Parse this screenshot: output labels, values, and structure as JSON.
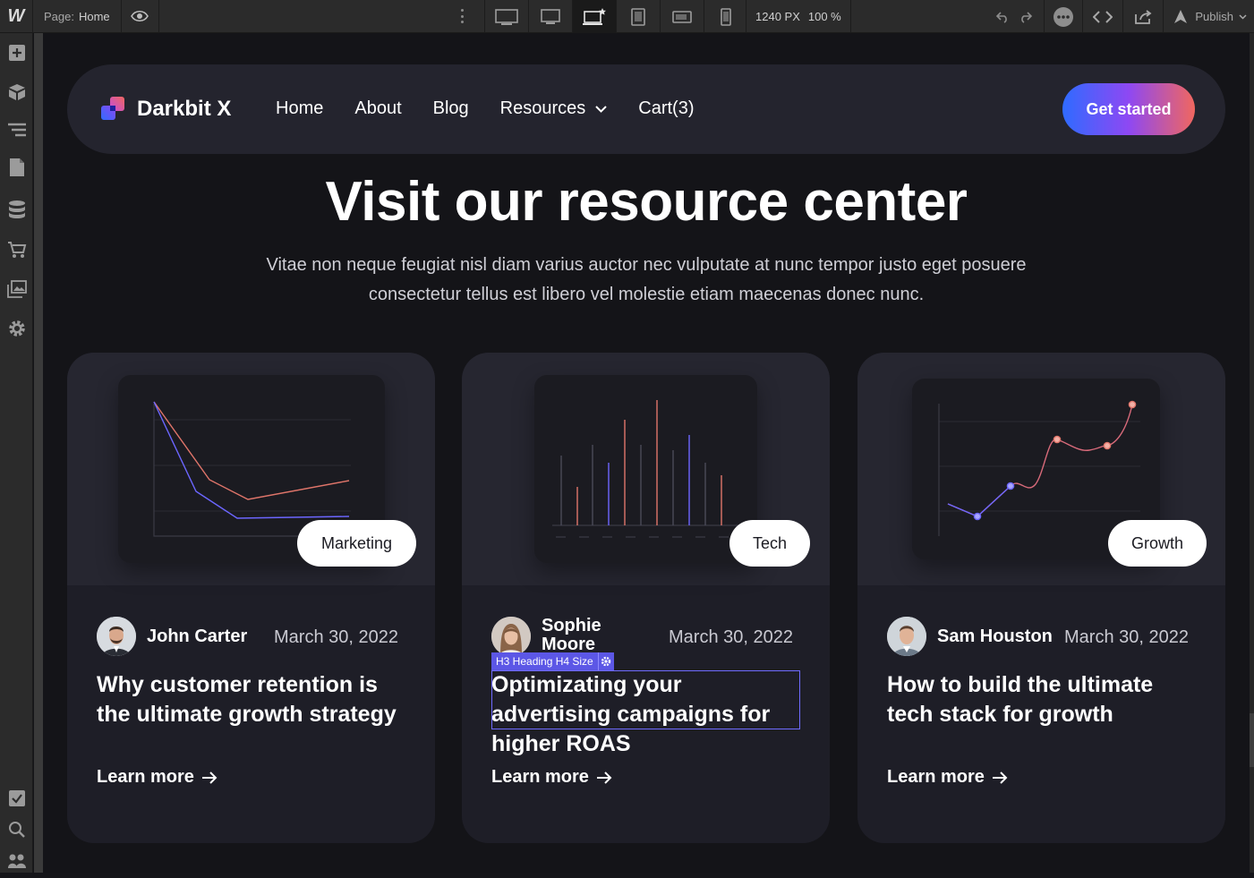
{
  "designer": {
    "logo": "W",
    "page_label": "Page:",
    "page_name": "Home",
    "canvas_width": "1240 PX",
    "zoom": "100 %",
    "publish_label": "Publish"
  },
  "site": {
    "brand": "Darkbit X",
    "nav": [
      "Home",
      "About",
      "Blog",
      "Resources",
      "Cart(3)"
    ],
    "cta": "Get started",
    "heading": "Visit our resource center",
    "subheading": "Vitae non neque feugiat nisl diam varius auctor nec vulputate at nunc tempor justo eget posuere consectetur tellus est libero vel molestie etiam maecenas donec nunc.",
    "learn_more": "Learn more",
    "selection_label": "H3 Heading H4 Size",
    "cards": [
      {
        "tag": "Marketing",
        "author": "John Carter",
        "date": "March 30, 2022",
        "title": "Why customer retention is the ultimate growth strategy"
      },
      {
        "tag": "Tech",
        "author": "Sophie Moore",
        "date": "March 30, 2022",
        "title": "Optimizating your advertising campaigns for higher ROAS"
      },
      {
        "tag": "Growth",
        "author": "Sam Houston",
        "date": "March 30, 2022",
        "title": "How to build the ultimate tech stack for growth"
      }
    ]
  },
  "colors": {
    "accent_blue": "#2f6bff",
    "accent_purple": "#8e48f3",
    "accent_coral": "#f0675f",
    "selection": "#5c57e6"
  }
}
